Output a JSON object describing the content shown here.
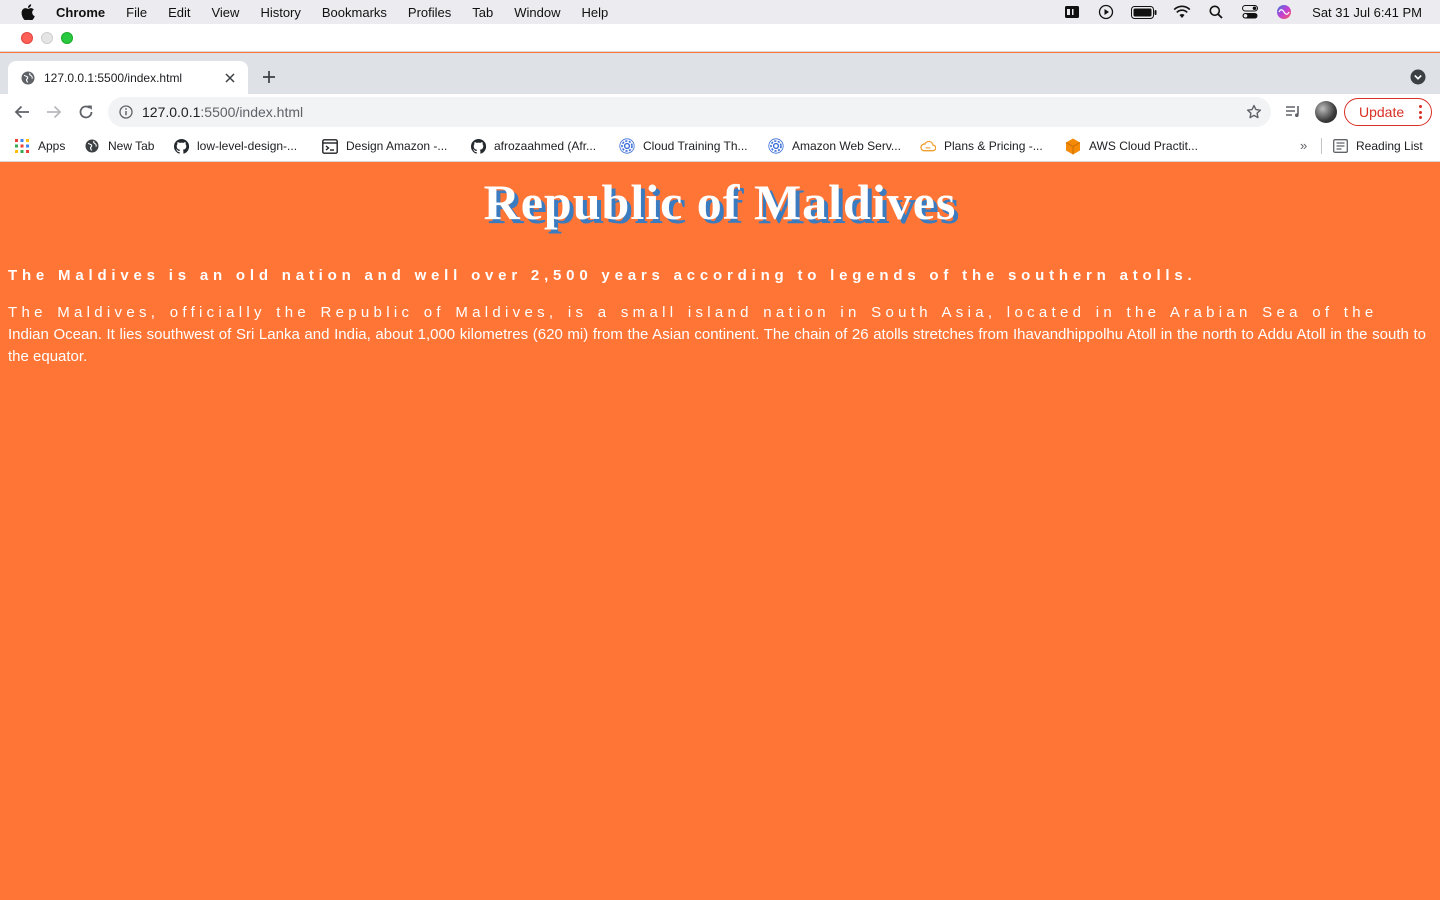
{
  "menubar": {
    "app": "Chrome",
    "items": [
      "File",
      "Edit",
      "View",
      "History",
      "Bookmarks",
      "Profiles",
      "Tab",
      "Window",
      "Help"
    ],
    "clock": "Sat 31 Jul  6:41 PM"
  },
  "tab": {
    "title": "127.0.0.1:5500/index.html"
  },
  "omnibox": {
    "host": "127.0.0.1",
    "path": ":5500/index.html"
  },
  "toolbar": {
    "update_label": "Update"
  },
  "bookmarks": {
    "items": [
      {
        "label": "Apps",
        "icon": "apps-grid-icon"
      },
      {
        "label": "New Tab",
        "icon": "globe-icon"
      },
      {
        "label": "low-level-design-...",
        "icon": "github-icon"
      },
      {
        "label": "Design Amazon -...",
        "icon": "terminal-icon"
      },
      {
        "label": "afrozaahmed (Afr...",
        "icon": "github-icon"
      },
      {
        "label": "Cloud Training Th...",
        "icon": "cloud-gear-icon"
      },
      {
        "label": "Amazon Web Serv...",
        "icon": "cloud-gear-icon"
      },
      {
        "label": "Plans & Pricing -...",
        "icon": "cloud-icon"
      },
      {
        "label": "AWS Cloud Practit...",
        "icon": "aws-cube-icon"
      }
    ],
    "more": "»",
    "reading_list": "Reading List"
  },
  "page": {
    "heading": "Republic of Maldives",
    "lead": "The Maldives is an old nation and well over 2,500 years according to legends of the southern atolls.",
    "body_line1": "The Maldives, officially the Republic of Maldives, is a small island nation in South Asia, located in the Arabian Sea of the",
    "body_rest": "Indian Ocean. It lies southwest of Sri Lanka and India, about 1,000 kilometres (620 mi) from the Asian continent. The chain of 26 atolls stretches from Ihavandhippolhu Atoll in the north to Addu Atoll in the south to the equator."
  },
  "colors": {
    "page_background": "#ff7536",
    "heading_shadow": "#3b7bbf",
    "update_accent": "#d93025"
  }
}
